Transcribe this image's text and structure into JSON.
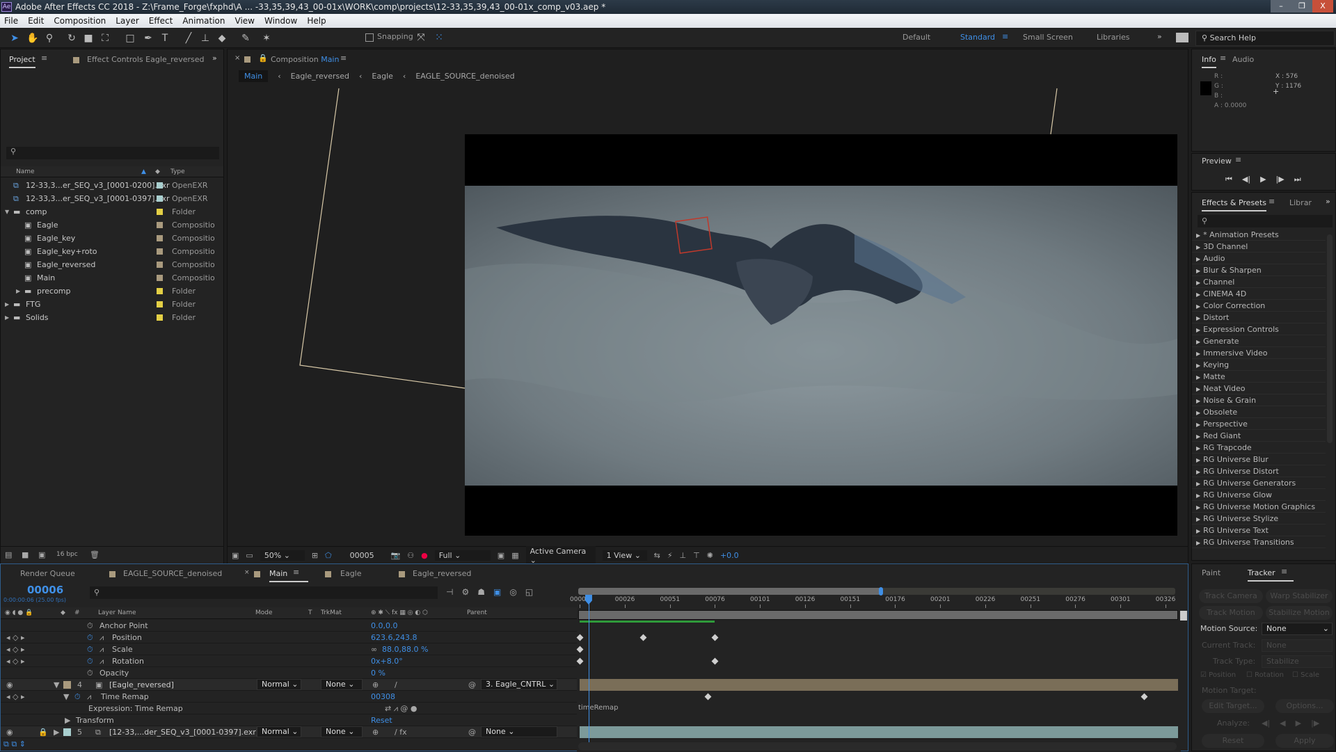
{
  "title": "Adobe After Effects CC 2018 - Z:\\Frame_Forge\\fxphd\\A ... -33,35,39,43_00-01x\\WORK\\comp\\projects\\12-33,35,39,43_00-01x_comp_v03.aep *",
  "app_icon": "Ae",
  "window_controls": {
    "minimize": "–",
    "restore": "❐",
    "close": "X"
  },
  "menu": [
    "File",
    "Edit",
    "Composition",
    "Layer",
    "Effect",
    "Animation",
    "View",
    "Window",
    "Help"
  ],
  "toolbar": {
    "snapping_label": "Snapping",
    "snapping_checked": false
  },
  "workspaces": [
    "Default",
    "Standard",
    "Small Screen",
    "Libraries"
  ],
  "active_workspace": "Standard",
  "search_help_placeholder": "Search Help",
  "project": {
    "tab_label": "Project",
    "effect_controls_tab": "Effect Controls Eagle_reversed",
    "columns": {
      "name": "Name",
      "type": "Type"
    },
    "items": [
      {
        "name": "12-33,3...er_SEQ_v3_[0001-0200].exr",
        "type": "OpenEXR",
        "indent": 0,
        "kind": "footage",
        "color": "#a9cfcf"
      },
      {
        "name": "12-33,3...er_SEQ_v3_[0001-0397].exr",
        "type": "OpenEXR",
        "indent": 0,
        "kind": "footage",
        "color": "#a9cfcf"
      },
      {
        "name": "comp",
        "type": "Folder",
        "indent": 0,
        "kind": "folder-open",
        "color": "#e3cf45"
      },
      {
        "name": "Eagle",
        "type": "Compositio",
        "indent": 1,
        "kind": "comp",
        "color": "#a99a7e"
      },
      {
        "name": "Eagle_key",
        "type": "Compositio",
        "indent": 1,
        "kind": "comp",
        "color": "#a99a7e"
      },
      {
        "name": "Eagle_key+roto",
        "type": "Compositio",
        "indent": 1,
        "kind": "comp",
        "color": "#a99a7e"
      },
      {
        "name": "Eagle_reversed",
        "type": "Compositio",
        "indent": 1,
        "kind": "comp",
        "color": "#a99a7e"
      },
      {
        "name": "Main",
        "type": "Compositio",
        "indent": 1,
        "kind": "comp",
        "color": "#a99a7e"
      },
      {
        "name": "precomp",
        "type": "Folder",
        "indent": 1,
        "kind": "folder",
        "color": "#e3cf45"
      },
      {
        "name": "FTG",
        "type": "Folder",
        "indent": 0,
        "kind": "folder",
        "color": "#e3cf45"
      },
      {
        "name": "Solids",
        "type": "Folder",
        "indent": 0,
        "kind": "folder",
        "color": "#e3cf45"
      }
    ],
    "bpc": "16 bpc"
  },
  "composition": {
    "tab_prefix": "Composition",
    "tab_name": "Main",
    "breadcrumbs": [
      "Main",
      "Eagle_reversed",
      "Eagle",
      "EAGLE_SOURCE_denoised"
    ],
    "zoom": "50%",
    "timecode": "00005",
    "resolution": "Full",
    "camera": "Active Camera",
    "views": "1 View",
    "exposure": "+0.0"
  },
  "info": {
    "tab": "Info",
    "audio_tab": "Audio",
    "r": "R :",
    "g": "G :",
    "b": "B :",
    "a": "A :  0.0000",
    "x": "X : 576",
    "y": "Y : 1176"
  },
  "preview": {
    "title": "Preview"
  },
  "effects": {
    "tab": "Effects & Presets",
    "libraries_tab": "Librar",
    "items": [
      "* Animation Presets",
      "3D Channel",
      "Audio",
      "Blur & Sharpen",
      "Channel",
      "CINEMA 4D",
      "Color Correction",
      "Distort",
      "Expression Controls",
      "Generate",
      "Immersive Video",
      "Keying",
      "Matte",
      "Neat Video",
      "Noise & Grain",
      "Obsolete",
      "Perspective",
      "Red Giant",
      "RG Trapcode",
      "RG Universe Blur",
      "RG Universe Distort",
      "RG Universe Generators",
      "RG Universe Glow",
      "RG Universe Motion Graphics",
      "RG Universe Stylize",
      "RG Universe Text",
      "RG Universe Transitions"
    ]
  },
  "timeline": {
    "tabs": [
      "Render Queue",
      "EAGLE_SOURCE_denoised",
      "Main",
      "Eagle",
      "Eagle_reversed"
    ],
    "active_tab": "Main",
    "current_time": "00006",
    "current_time_sub": "0:00:00:06 (25.00 fps)",
    "columns": {
      "layer_name": "Layer Name",
      "mode": "Mode",
      "t": "T",
      "trkmat": "TrkMat",
      "parent": "Parent"
    },
    "rows": {
      "anchor": {
        "label": "Anchor Point",
        "value": "0.0,0.0"
      },
      "position": {
        "label": "Position",
        "value": "623.6,243.8"
      },
      "scale": {
        "label": "Scale",
        "value": "88.0,88.0 %"
      },
      "rotation": {
        "label": "Rotation",
        "value": "0x+8.0°"
      },
      "opacity": {
        "label": "Opacity",
        "value": "0 %"
      },
      "layer4": {
        "num": "4",
        "name": "[Eagle_reversed]",
        "mode": "Normal",
        "trkmat": "None",
        "parent": "3. Eagle_CNTRL",
        "color": "#a99a7e"
      },
      "time_remap": {
        "label": "Time Remap",
        "value": "00308"
      },
      "expression": {
        "label": "Expression: Time Remap",
        "expr_text": "timeRemap"
      },
      "transform": {
        "label": "Transform",
        "value": "Reset"
      },
      "layer5": {
        "num": "5",
        "name": "[12-33,...der_SEQ_v3_[0001-0397].exr]",
        "mode": "Normal",
        "trkmat": "None",
        "parent": "None",
        "color": "#a9cfcf"
      }
    },
    "ruler_labels": [
      "0000",
      "00026",
      "00051",
      "00076",
      "00101",
      "00126",
      "00151",
      "00176",
      "00201",
      "00226",
      "00251",
      "00276",
      "00301",
      "00326"
    ],
    "frame_range": [
      1,
      326
    ],
    "playhead_frame": 6,
    "work_area_end_frame": 168,
    "cached_until_frame": 76,
    "keyframes": {
      "position": [
        1,
        36,
        76
      ],
      "scale": [
        1
      ],
      "rotation": [
        1,
        76
      ],
      "time_remap": [
        72,
        314
      ]
    }
  },
  "tracker": {
    "paint_tab": "Paint",
    "tracker_tab": "Tracker",
    "buttons": [
      "Track Camera",
      "Warp Stabilizer",
      "Track Motion",
      "Stabilize Motion"
    ],
    "motion_source_label": "Motion Source:",
    "motion_source": "None",
    "current_track_label": "Current Track:",
    "current_track": "None",
    "track_type_label": "Track Type:",
    "track_type": "Stabilize",
    "position_label": "Position",
    "position_checked": true,
    "rotation_label": "Rotation",
    "rotation_checked": false,
    "scale_label": "Scale",
    "scale_checked": false,
    "motion_target_label": "Motion Target:",
    "edit_target": "Edit Target...",
    "options": "Options...",
    "analyze_label": "Analyze:",
    "reset": "Reset",
    "apply": "Apply"
  }
}
